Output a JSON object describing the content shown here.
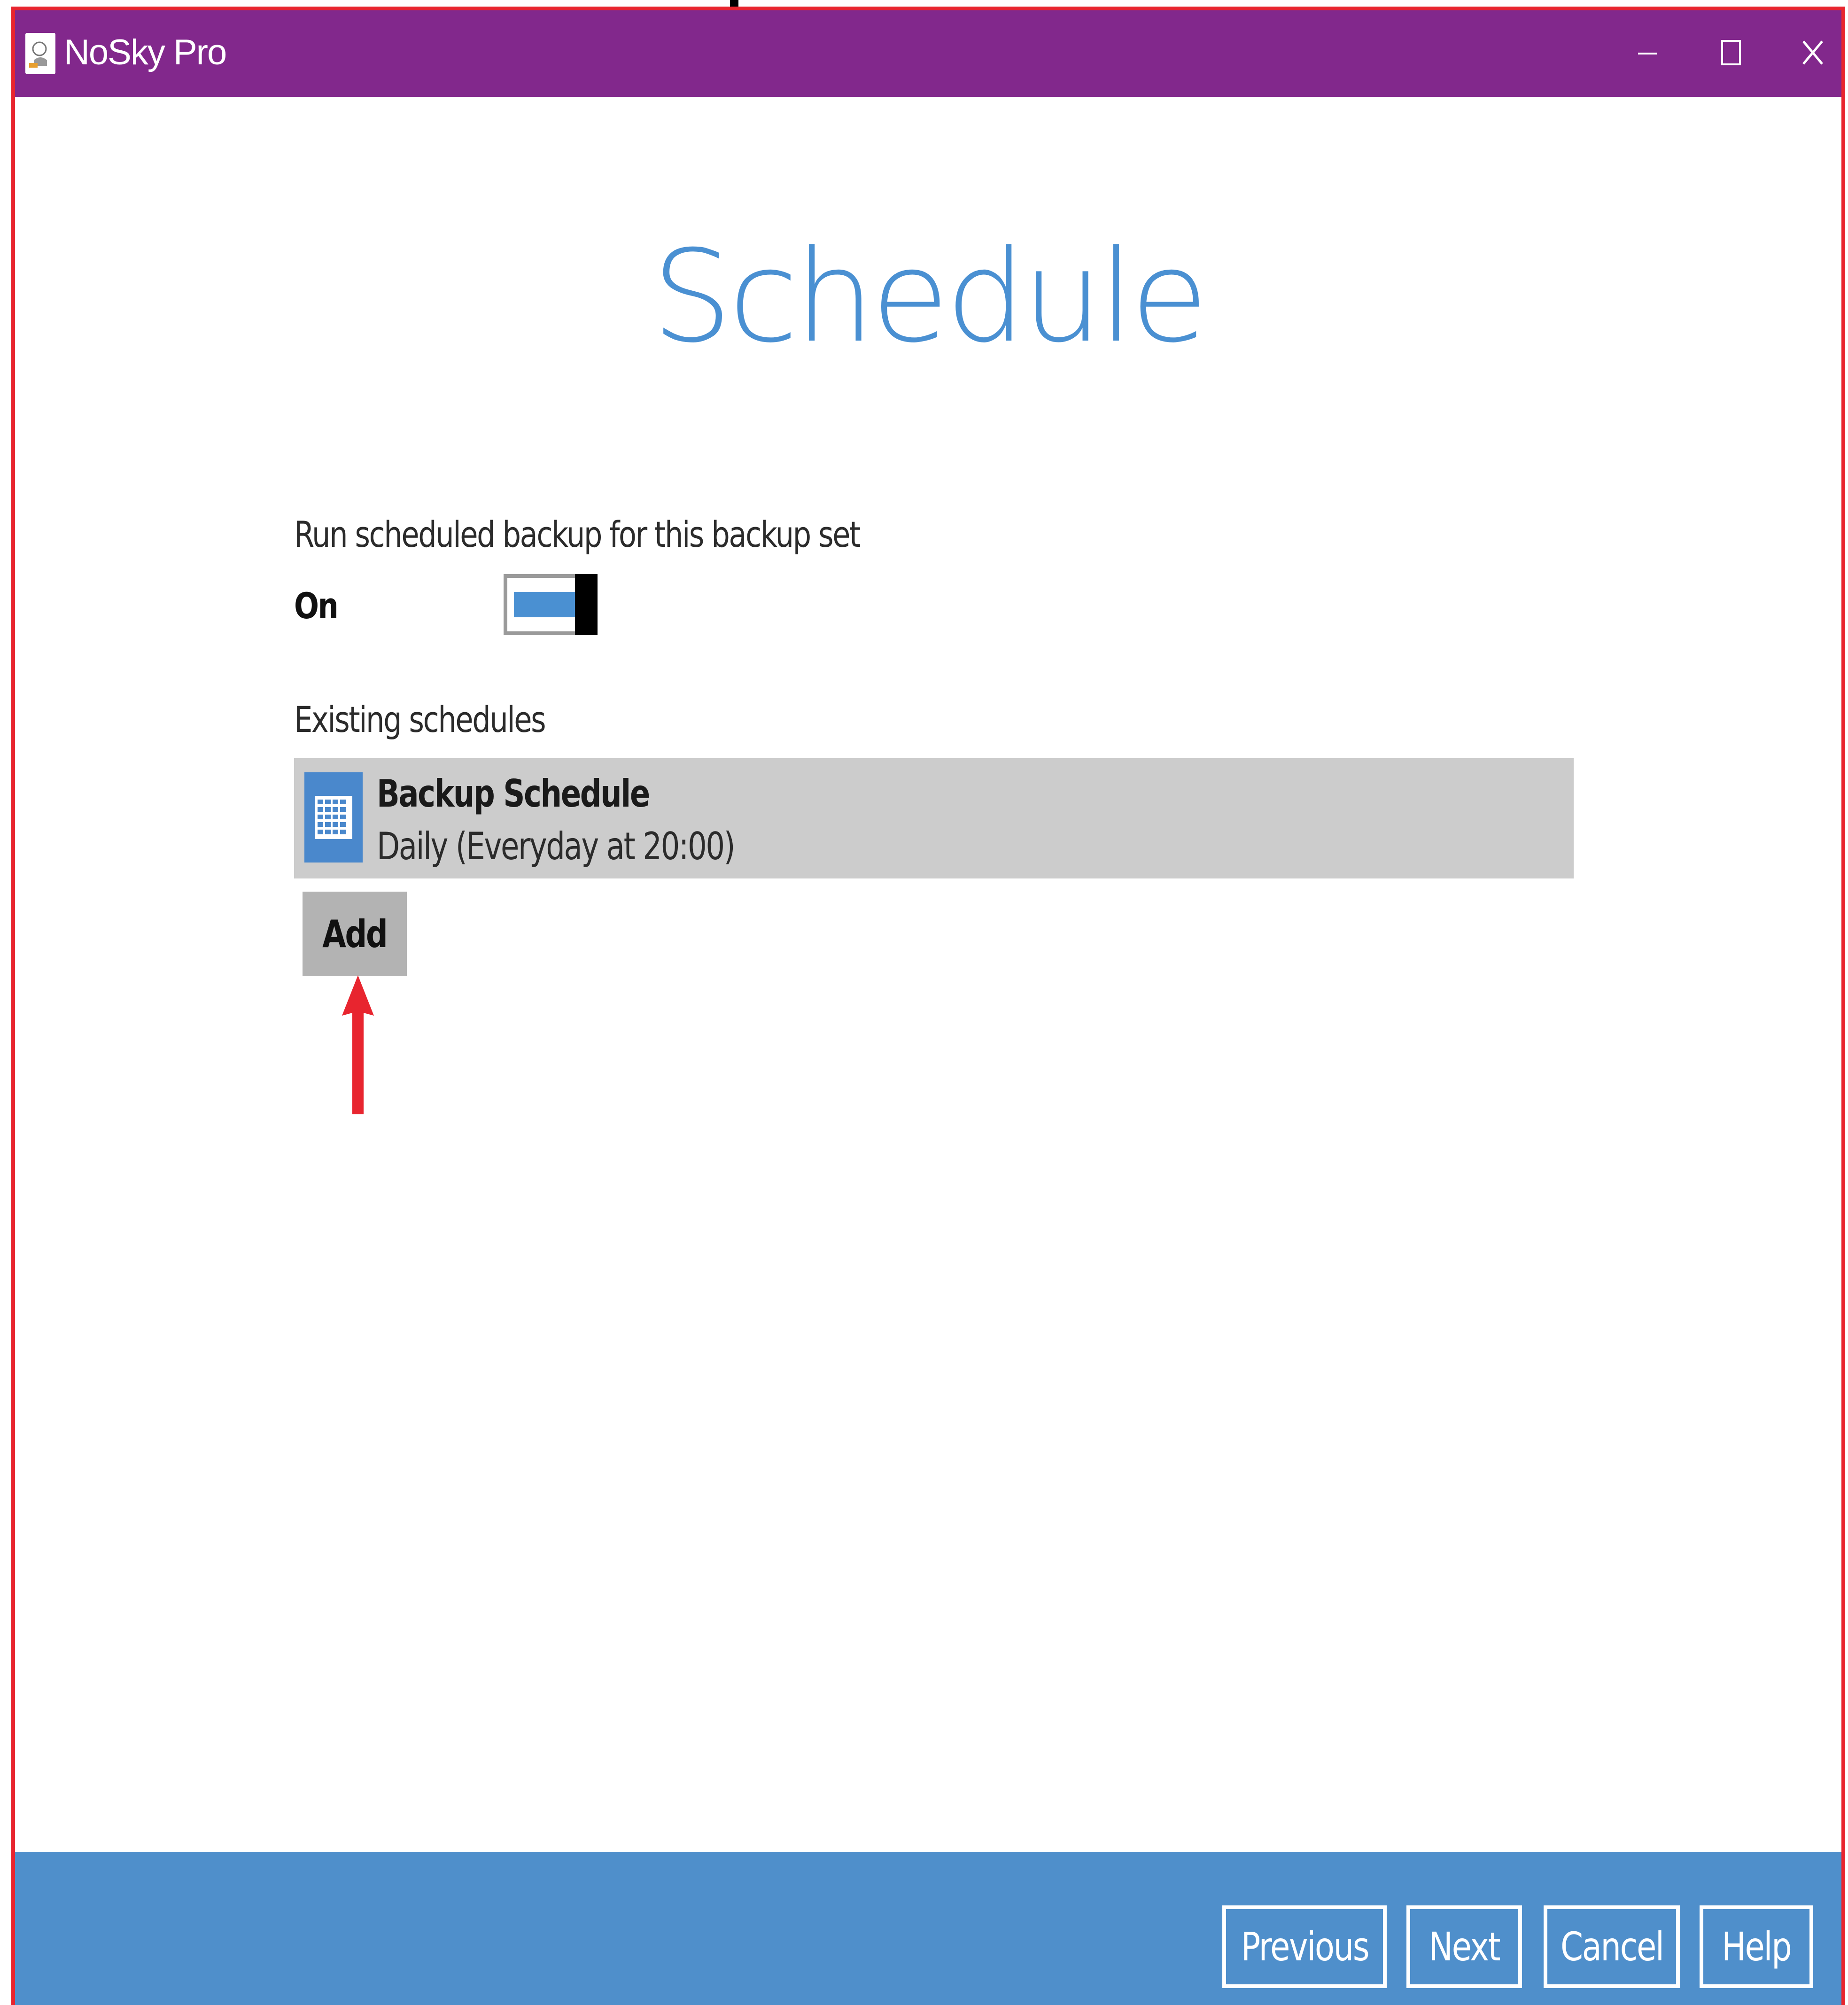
{
  "window": {
    "title": "NoSky Pro",
    "icon": "nosky-app-icon"
  },
  "title_controls": {
    "minimize_icon": "minimize-icon",
    "maximize_icon": "maximize-icon",
    "close_icon": "close-icon"
  },
  "page": {
    "title": "Schedule"
  },
  "scheduled_backup": {
    "label": "Run scheduled backup for this backup set",
    "state_text": "On",
    "enabled": true
  },
  "existing": {
    "label": "Existing schedules",
    "items": [
      {
        "name": "Backup Schedule",
        "description": "Daily (Everyday at 20:00)",
        "icon": "calendar-icon"
      }
    ],
    "add_label": "Add"
  },
  "footer": {
    "previous_label": "Previous",
    "next_label": "Next",
    "cancel_label": "Cancel",
    "help_label": "Help"
  },
  "colors": {
    "titlebar": "#82288c",
    "accent": "#4a90d2",
    "footer": "#4f8fcb",
    "annotation": "#e8252f",
    "selected_row": "#cccccc"
  }
}
